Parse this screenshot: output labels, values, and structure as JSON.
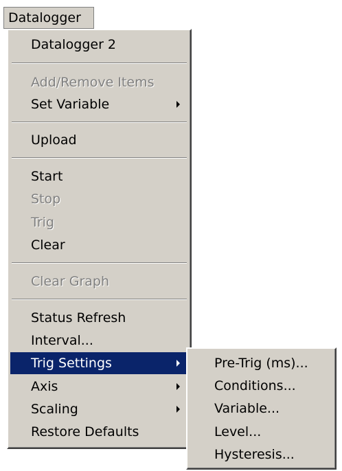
{
  "menubar": {
    "title": "Datalogger"
  },
  "menu": {
    "items": {
      "datalogger2": "Datalogger 2",
      "add_remove": "Add/Remove Items",
      "set_variable": "Set Variable",
      "upload": "Upload",
      "start": "Start",
      "stop": "Stop",
      "trig": "Trig",
      "clear": "Clear",
      "clear_graph": "Clear Graph",
      "status_refresh": "Status Refresh",
      "interval": "Interval...",
      "trig_settings": "Trig Settings",
      "axis": "Axis",
      "scaling": "Scaling",
      "restore_defaults": "Restore Defaults"
    }
  },
  "submenu": {
    "items": {
      "pre_trig": "Pre-Trig (ms)...",
      "conditions": "Conditions...",
      "variable": "Variable...",
      "level": "Level...",
      "hysteresis": "Hysteresis..."
    }
  },
  "colors": {
    "menu_bg": "#d4d0c8",
    "highlight": "#0a246a",
    "disabled_text": "#808080"
  }
}
